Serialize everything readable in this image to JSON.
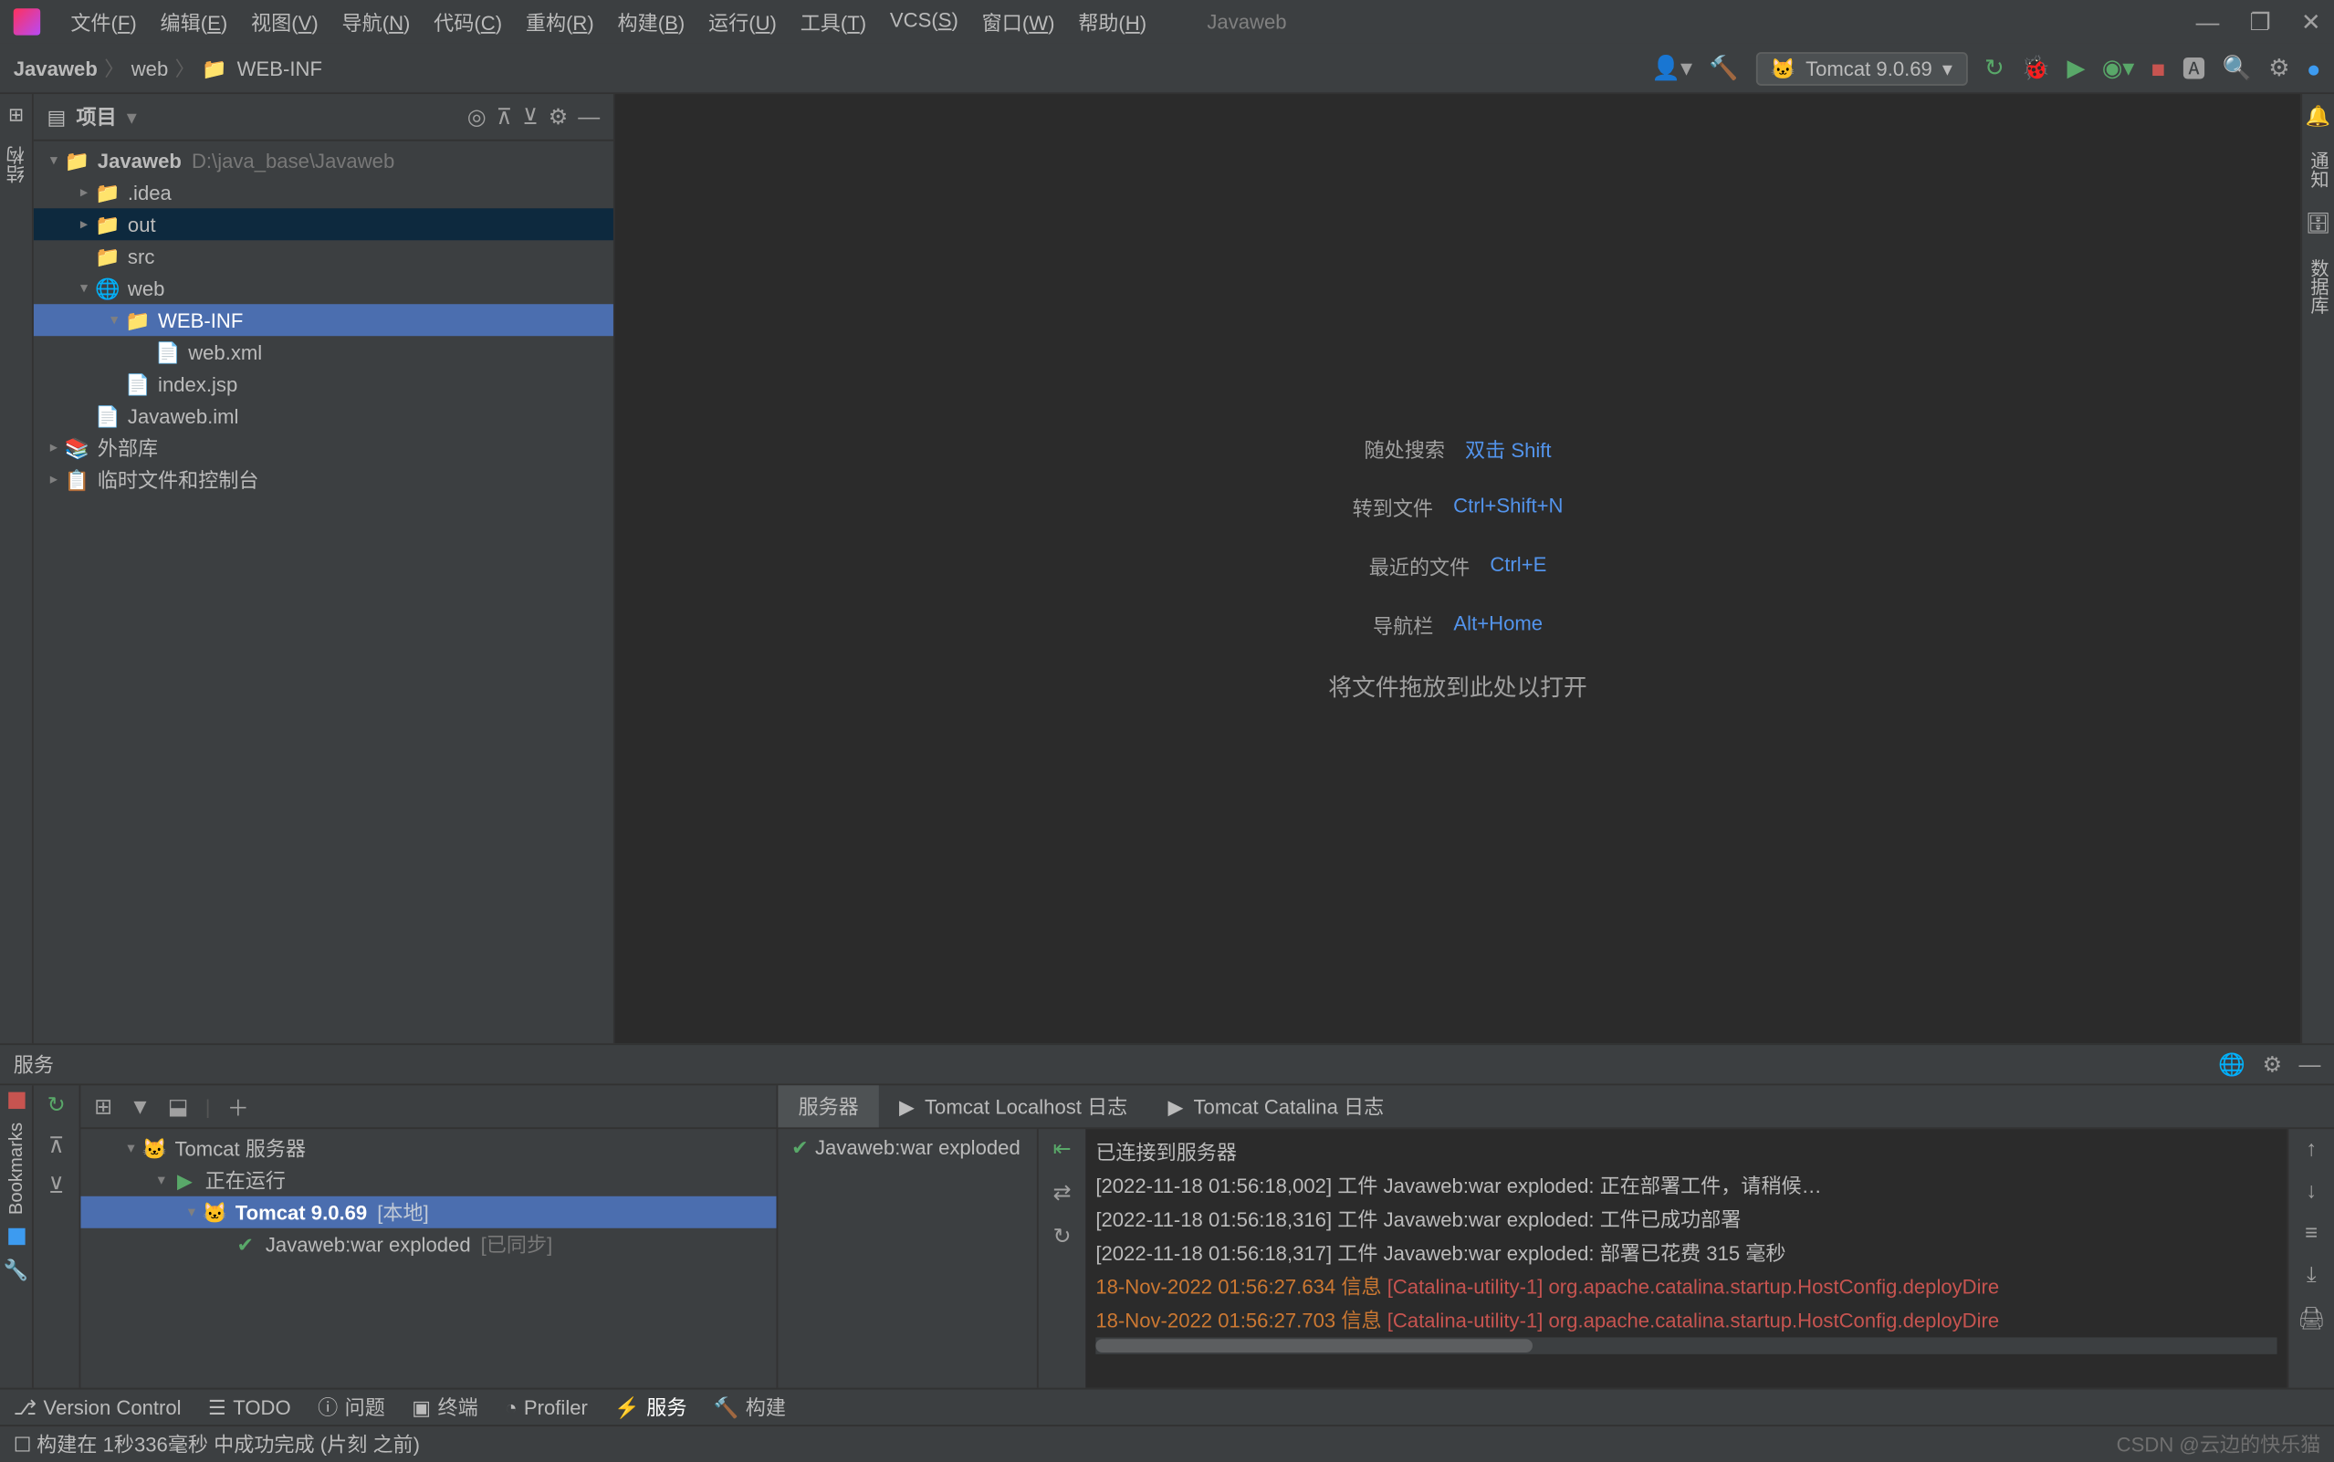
{
  "app_title": "Javaweb",
  "menu": [
    {
      "label": "文件",
      "key": "F"
    },
    {
      "label": "编辑",
      "key": "E"
    },
    {
      "label": "视图",
      "key": "V"
    },
    {
      "label": "导航",
      "key": "N"
    },
    {
      "label": "代码",
      "key": "C"
    },
    {
      "label": "重构",
      "key": "R"
    },
    {
      "label": "构建",
      "key": "B"
    },
    {
      "label": "运行",
      "key": "U"
    },
    {
      "label": "工具",
      "key": "T"
    },
    {
      "label": "VCS",
      "key": "S"
    },
    {
      "label": "窗口",
      "key": "W"
    },
    {
      "label": "帮助",
      "key": "H"
    }
  ],
  "breadcrumb": [
    "Javaweb",
    "web",
    "WEB-INF"
  ],
  "run_config": "Tomcat 9.0.69",
  "project_panel_title": "项目",
  "tree": {
    "root": {
      "label": "Javaweb",
      "hint": "D:\\java_base\\Javaweb"
    },
    "idea": ".idea",
    "out": "out",
    "src": "src",
    "web": "web",
    "webinf": "WEB-INF",
    "webxml": "web.xml",
    "indexjsp": "index.jsp",
    "iml": "Javaweb.iml",
    "extlib": "外部库",
    "scratch": "临时文件和控制台"
  },
  "editor_hints": [
    {
      "lbl": "随处搜索",
      "key": "双击 Shift"
    },
    {
      "lbl": "转到文件",
      "key": "Ctrl+Shift+N"
    },
    {
      "lbl": "最近的文件",
      "key": "Ctrl+E"
    },
    {
      "lbl": "导航栏",
      "key": "Alt+Home"
    }
  ],
  "editor_drag_hint": "将文件拖放到此处以打开",
  "services_title": "服务",
  "services_tabs": [
    "服务器",
    "Tomcat Localhost 日志",
    "Tomcat Catalina 日志"
  ],
  "services_tree": {
    "tomcat_server": "Tomcat 服务器",
    "running": "正在运行",
    "tomcat_node": "Tomcat 9.0.69",
    "tomcat_node_hint": "[本地]",
    "artifact": "Javaweb:war exploded",
    "artifact_hint": "[已同步]"
  },
  "deploy_artifact": "Javaweb:war exploded",
  "console_lines": [
    {
      "type": "info",
      "text": "已连接到服务器"
    },
    {
      "type": "info",
      "ts": "[2022-11-18 01:56:18,002]",
      "cat": "工件",
      "art": "Javaweb:war exploded:",
      "msg": "正在部署工件，请稍候…"
    },
    {
      "type": "info",
      "ts": "[2022-11-18 01:56:18,316]",
      "cat": "工件",
      "art": "Javaweb:war exploded:",
      "msg": "工件已成功部署"
    },
    {
      "type": "info",
      "ts": "[2022-11-18 01:56:18,317]",
      "cat": "工件",
      "art": "Javaweb:war exploded:",
      "msg": "部署已花费 315 毫秒"
    },
    {
      "type": "red",
      "ts": "18-Nov-2022 01:56:27.634",
      "cat": "信息",
      "msg": "[Catalina-utility-1] org.apache.catalina.startup.HostConfig.deployDire"
    },
    {
      "type": "red",
      "ts": "18-Nov-2022 01:56:27.703",
      "cat": "信息",
      "msg": "[Catalina-utility-1] org.apache.catalina.startup.HostConfig.deployDire"
    }
  ],
  "bottom_tabs": [
    {
      "icon": "branch",
      "label": "Version Control"
    },
    {
      "icon": "list",
      "label": "TODO"
    },
    {
      "icon": "info",
      "label": "问题"
    },
    {
      "icon": "terminal",
      "label": "终端"
    },
    {
      "icon": "profiler",
      "label": "Profiler"
    },
    {
      "icon": "services",
      "label": "服务",
      "active": true
    },
    {
      "icon": "hammer",
      "label": "构建"
    }
  ],
  "status_text": "构建在 1秒336毫秒 中成功完成 (片刻 之前)",
  "watermark": "CSDN @云边的快乐猫",
  "right_gutter": [
    "通知",
    "数据库"
  ],
  "left_gutter_label": "结构",
  "left_strip_label": "Bookmarks"
}
